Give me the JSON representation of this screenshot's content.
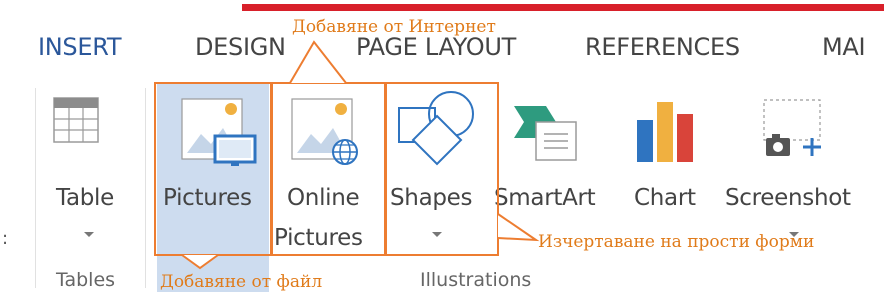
{
  "ribbon": {
    "tabs": [
      {
        "label": "INSERT",
        "active": true
      },
      {
        "label": "DESIGN",
        "active": false
      },
      {
        "label": "PAGE LAYOUT",
        "active": false
      },
      {
        "label": "REFERENCES",
        "active": false
      },
      {
        "label": "MAI",
        "active": false
      }
    ],
    "active_tab_color": "#2b579a"
  },
  "groups": {
    "tables": {
      "label": "Tables",
      "buttons": {
        "table": {
          "label": "Table",
          "icon": "table-icon",
          "has_dropdown": true
        }
      }
    },
    "illustrations": {
      "label": "Illustrations",
      "buttons": {
        "pictures": {
          "label": "Pictures",
          "icon": "pictures-icon",
          "selected": true
        },
        "online_pictures": {
          "label_line1": "Online",
          "label_line2": "Pictures",
          "icon": "online-pictures-icon"
        },
        "shapes": {
          "label": "Shapes",
          "icon": "shapes-icon",
          "has_dropdown": true
        },
        "smartart": {
          "label": "SmartArt",
          "icon": "smartart-icon"
        },
        "chart": {
          "label": "Chart",
          "icon": "chart-icon"
        },
        "screenshot": {
          "label": "Screenshot",
          "icon": "screenshot-icon",
          "has_dropdown": true
        }
      }
    }
  },
  "annotations": {
    "online": "Добавяне от Интернет",
    "shapes": "Изчертаване на прости форми",
    "file": "Добавяне от файл",
    "color": "#ed7d31"
  },
  "colors": {
    "selected_background": "#cddcef",
    "top_bar": "#d8202a"
  }
}
